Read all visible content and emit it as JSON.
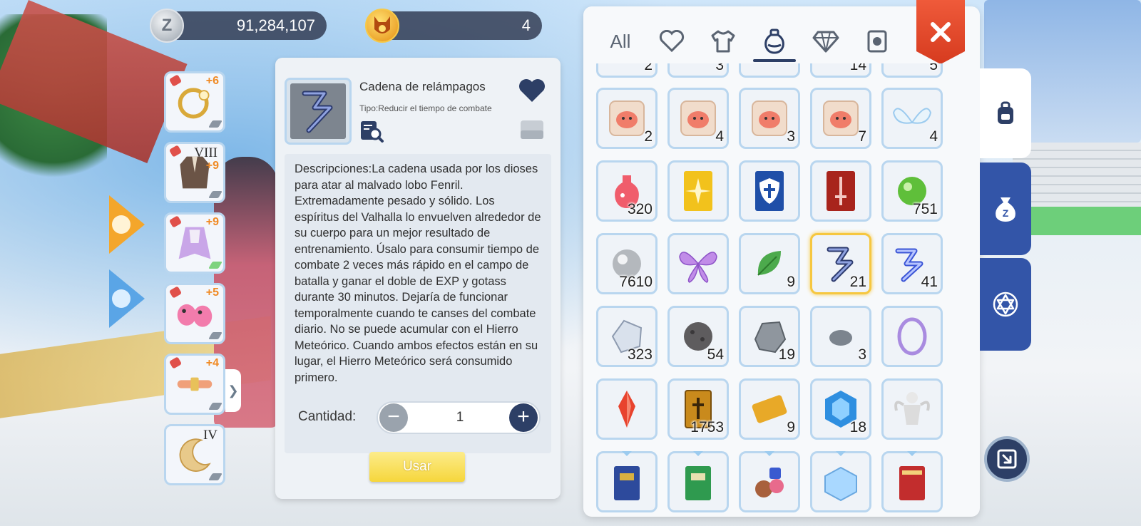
{
  "currencies": {
    "zeny": {
      "icon": "zeny-coin-icon",
      "symbol": "Z",
      "value": "91,284,107"
    },
    "cat_coin": {
      "icon": "cat-coin-icon",
      "value": "4"
    }
  },
  "equipment": [
    {
      "name": "equip-slot-ring",
      "icon": "ring-icon",
      "refine": "+6",
      "tier": ""
    },
    {
      "name": "equip-slot-coat",
      "icon": "coat-icon",
      "refine": "+9",
      "tier": "VIII"
    },
    {
      "name": "equip-slot-cape",
      "icon": "cape-icon",
      "refine": "+9",
      "tier": ""
    },
    {
      "name": "equip-slot-shoes",
      "icon": "shoes-icon",
      "refine": "+5",
      "tier": ""
    },
    {
      "name": "equip-slot-belt",
      "icon": "belt-icon",
      "refine": "+4",
      "tier": ""
    },
    {
      "name": "equip-slot-moon",
      "icon": "moon-accessory-icon",
      "refine": "",
      "tier": "IV"
    }
  ],
  "detail": {
    "item_name": "Cadena de relámpagos",
    "item_type": "Tipo:Reducir el tiempo de combate",
    "description": "Descripciones:La cadena usada por los dioses para atar al malvado lobo Fenril. Extremadamente pesado y sólido. Los espíritus del Valhalla lo envuelven alrededor de su cuerpo para un mejor resultado de entrenamiento. Úsalo para consumir tiempo de combate 2 veces más rápido en el campo de batalla y ganar el doble de EXP y gotass durante 30 minutos. Dejaría de funcionar temporalmente cuando te canses del combate diario. No se puede acumular con el Hierro Meteórico. Cuando ambos efectos están en su lugar, el Hierro Meteórico será consumido primero.",
    "quantity_label": "Cantidad:",
    "quantity_value": "1",
    "use_label": "Usar"
  },
  "inventory": {
    "tabs": [
      {
        "label": "All",
        "icon": ""
      },
      {
        "label": "",
        "icon": "heart-outline-icon"
      },
      {
        "label": "",
        "icon": "shirt-icon"
      },
      {
        "label": "",
        "icon": "potion-icon"
      },
      {
        "label": "",
        "icon": "diamond-icon"
      },
      {
        "label": "",
        "icon": "pet-card-icon"
      }
    ],
    "active_tab": 3,
    "partial_row_counts": [
      "2",
      "3",
      "",
      "14",
      "5"
    ],
    "rows": [
      [
        {
          "icon": "poring-scroll-icon",
          "count": "2"
        },
        {
          "icon": "poring-scroll-icon",
          "count": "4"
        },
        {
          "icon": "poring-scroll-icon",
          "count": "3"
        },
        {
          "icon": "poring-scroll-icon",
          "count": "7"
        },
        {
          "icon": "angel-wings-icon",
          "count": "4"
        }
      ],
      [
        {
          "icon": "red-potion-icon",
          "count": "320"
        },
        {
          "icon": "gold-star-card-icon",
          "count": ""
        },
        {
          "icon": "shield-card-icon",
          "count": ""
        },
        {
          "icon": "sword-card-icon",
          "count": ""
        },
        {
          "icon": "green-orb-icon",
          "count": "751"
        }
      ],
      [
        {
          "icon": "silver-pearl-icon",
          "count": "7610"
        },
        {
          "icon": "butterfly-wings-icon",
          "count": ""
        },
        {
          "icon": "leaf-icon",
          "count": "9"
        },
        {
          "icon": "lightning-chain-icon",
          "count": "21",
          "selected": true
        },
        {
          "icon": "blue-chain-icon",
          "count": "41"
        }
      ],
      [
        {
          "icon": "crystal-ore-icon",
          "count": "323"
        },
        {
          "icon": "dark-ore-icon",
          "count": "54"
        },
        {
          "icon": "gray-rock-icon",
          "count": "19"
        },
        {
          "icon": "small-stone-icon",
          "count": "3"
        },
        {
          "icon": "purple-ring-frame-icon",
          "count": ""
        }
      ],
      [
        {
          "icon": "red-crystal-icon",
          "count": ""
        },
        {
          "icon": "holy-book-icon",
          "count": "1753"
        },
        {
          "icon": "gold-ticket-icon",
          "count": "9"
        },
        {
          "icon": "blue-gem-icon",
          "count": "18"
        },
        {
          "icon": "angel-statue-icon",
          "count": ""
        }
      ],
      [
        {
          "icon": "blue-book-icon",
          "count": ""
        },
        {
          "icon": "green-book-icon",
          "count": ""
        },
        {
          "icon": "item-bundle-icon",
          "count": ""
        },
        {
          "icon": "crystal-box-icon",
          "count": ""
        },
        {
          "icon": "red-book-icon",
          "count": ""
        }
      ]
    ]
  },
  "side_tabs": [
    {
      "icon": "backpack-icon",
      "active": true
    },
    {
      "icon": "zeny-bag-icon",
      "active": false
    },
    {
      "icon": "hexagram-icon",
      "active": false
    }
  ],
  "colors": {
    "accent_navy": "#2d3f66",
    "slot_border": "#b9d6ef",
    "selected_border": "#f6c740",
    "close_red": "#e04a2b",
    "side_tab_blue": "#3355a8",
    "use_button_yellow": "#f6d63c"
  }
}
